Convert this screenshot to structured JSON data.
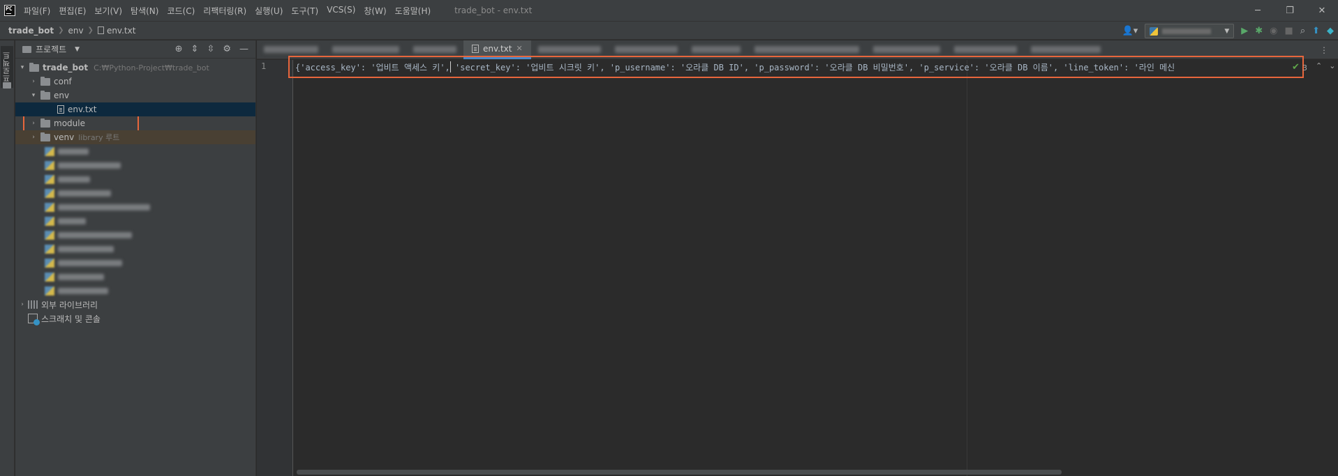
{
  "app": {
    "logo_text": "PC",
    "window_title": "trade_bot - env.txt"
  },
  "menu": [
    "파일(F)",
    "편집(E)",
    "보기(V)",
    "탐색(N)",
    "코드(C)",
    "리팩터링(R)",
    "실행(U)",
    "도구(T)",
    "VCS(S)",
    "창(W)",
    "도움말(H)"
  ],
  "breadcrumbs": {
    "project": "trade_bot",
    "folder": "env",
    "file": "env.txt"
  },
  "left_strip": {
    "tab_label": "프로젝트"
  },
  "project_panel": {
    "title": "프로젝트",
    "root_name": "trade_bot",
    "root_path": "C:₩Python-Project₩trade_bot",
    "items": {
      "conf": "conf",
      "env": "env",
      "env_txt": "env.txt",
      "module": "module",
      "venv": "venv",
      "venv_hint": "library 루트",
      "external_libs": "외부 라이브러리",
      "scratches": "스크래치 및 콘솔"
    }
  },
  "editor": {
    "active_tab": "env.txt",
    "line_number": "1",
    "code": "{'access_key': '업비트 액세스 키', 'secret_key': '업비트 시크릿 키', 'p_username': '오라클 DB ID', 'p_password': '오라클 DB 비밀번호', 'p_service': '오라클 DB 이름', 'line_token': '라인 메신",
    "inspection_count": "3"
  },
  "colors": {
    "highlight_box": "#e8663c",
    "selected_row": "#0d293e",
    "library_row": "#494033",
    "tab_underline": "#4a88c7"
  }
}
